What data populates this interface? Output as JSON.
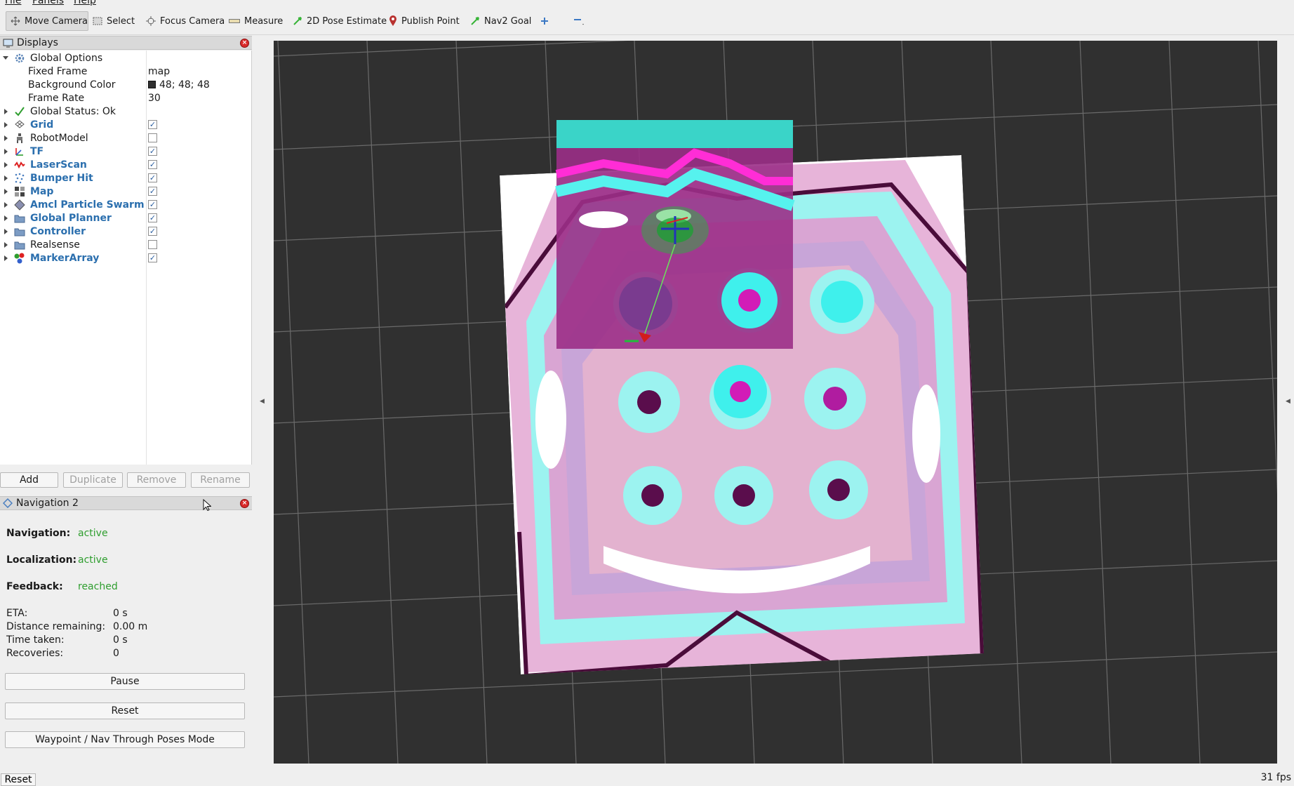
{
  "menu": {
    "file": "File",
    "panels": "Panels",
    "help": "Help"
  },
  "toolbar": {
    "move_camera": "Move Camera",
    "select": "Select",
    "focus_camera": "Focus Camera",
    "measure": "Measure",
    "pose_estimate": "2D Pose Estimate",
    "publish_point": "Publish Point",
    "nav2_goal": "Nav2 Goal"
  },
  "displays": {
    "title": "Displays",
    "global_options": "Global Options",
    "fixed_frame_label": "Fixed Frame",
    "fixed_frame_value": "map",
    "background_label": "Background Color",
    "background_value": "48; 48; 48",
    "frame_rate_label": "Frame Rate",
    "frame_rate_value": "30",
    "global_status": "Global Status: Ok",
    "items": [
      {
        "label": "Grid",
        "checked": true
      },
      {
        "label": "RobotModel",
        "checked": false
      },
      {
        "label": "TF",
        "checked": true
      },
      {
        "label": "LaserScan",
        "checked": true
      },
      {
        "label": "Bumper Hit",
        "checked": true
      },
      {
        "label": "Map",
        "checked": true
      },
      {
        "label": "Amcl Particle Swarm",
        "checked": true
      },
      {
        "label": "Global Planner",
        "checked": true
      },
      {
        "label": "Controller",
        "checked": true
      },
      {
        "label": "Realsense",
        "checked": false
      },
      {
        "label": "MarkerArray",
        "checked": true
      }
    ],
    "buttons": {
      "add": "Add",
      "duplicate": "Duplicate",
      "remove": "Remove",
      "rename": "Rename"
    }
  },
  "navigation": {
    "title": "Navigation 2",
    "navigation_label": "Navigation:",
    "navigation_value": "active",
    "localization_label": "Localization:",
    "localization_value": "active",
    "feedback_label": "Feedback:",
    "feedback_value": "reached",
    "eta_label": "ETA:",
    "eta_value": "0 s",
    "distance_label": "Distance remaining:",
    "distance_value": "0.00 m",
    "time_label": "Time taken:",
    "time_value": "0 s",
    "recoveries_label": "Recoveries:",
    "recoveries_value": "0",
    "pause": "Pause",
    "reset": "Reset",
    "waypoint_mode": "Waypoint / Nav Through Poses Mode"
  },
  "statusbar": {
    "reset": "Reset",
    "fps": "31 fps"
  },
  "colors": {
    "background": "#303030",
    "accent_blue": "#2b6fae",
    "status_green": "#2f9e2f"
  }
}
